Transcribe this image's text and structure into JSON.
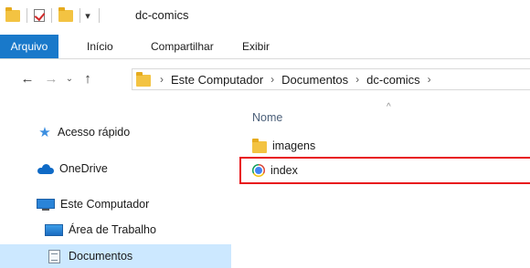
{
  "window": {
    "title": "dc-comics"
  },
  "quick_access_toolbar": {
    "icons": [
      "folder-icon",
      "checkmark-properties-icon",
      "new-folder-icon",
      "customize-arrow-icon"
    ],
    "customize_glyph": "▾"
  },
  "ribbon": {
    "file_tab": "Arquivo",
    "tabs": [
      "Início",
      "Compartilhar",
      "Exibir"
    ],
    "file_tab_color": "#1979ca"
  },
  "navigation": {
    "back": "←",
    "forward": "→",
    "recent": "⌄",
    "up": "↑",
    "breadcrumbs": [
      "Este Computador",
      "Documentos",
      "dc-comics"
    ],
    "crumb_separator": "›"
  },
  "sidebar": {
    "items": [
      {
        "label": "Acesso rápido",
        "icon": "star-icon"
      },
      {
        "label": "OneDrive",
        "icon": "cloud-icon"
      },
      {
        "label": "Este Computador",
        "icon": "computer-icon"
      },
      {
        "label": "Área de Trabalho",
        "icon": "desktop-icon"
      },
      {
        "label": "Documentos",
        "icon": "documents-icon",
        "selected": true
      }
    ],
    "selected_color": "#cce8ff"
  },
  "content": {
    "column_header": "Nome",
    "sort_indicator": "^",
    "files": [
      {
        "name": "imagens",
        "icon": "folder-icon"
      },
      {
        "name": "index",
        "icon": "chrome-icon",
        "highlighted": true
      }
    ],
    "highlight_color": "#e8141a"
  }
}
